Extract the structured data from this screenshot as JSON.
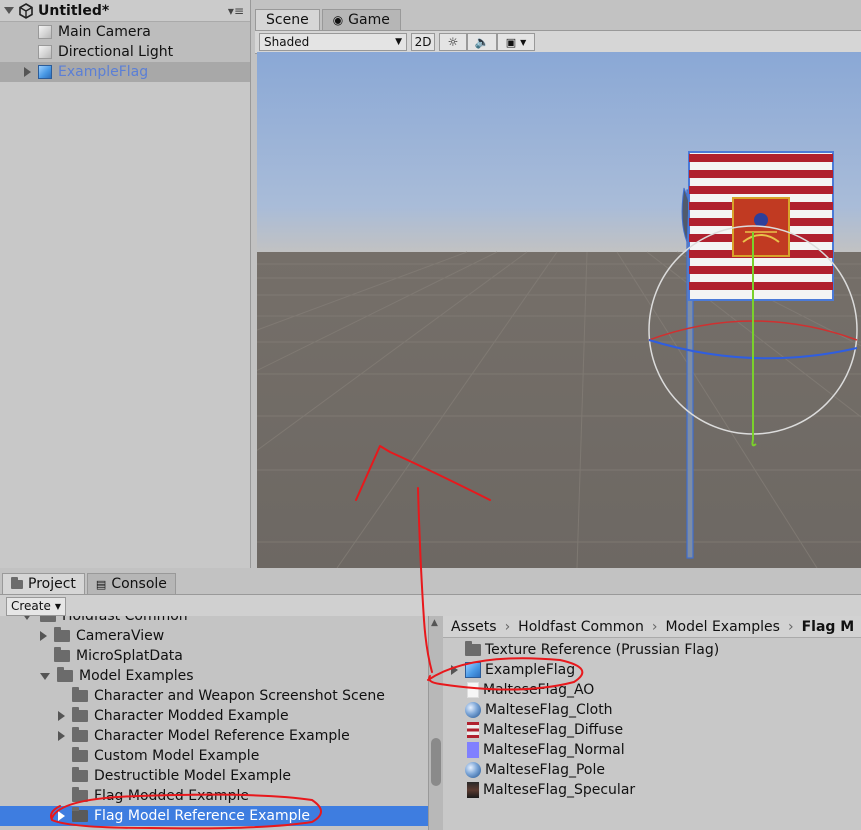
{
  "hierarchy": {
    "scene_name": "Untitled*",
    "items": [
      {
        "label": "Main Camera"
      },
      {
        "label": "Directional Light"
      },
      {
        "label": "ExampleFlag"
      }
    ]
  },
  "scene_view": {
    "tabs": [
      {
        "label": "Scene"
      },
      {
        "label": "Game"
      }
    ],
    "toolbar": {
      "shading_mode": "Shaded",
      "mode_2d": "2D"
    }
  },
  "project": {
    "tabs": [
      {
        "label": "Project"
      },
      {
        "label": "Console"
      }
    ],
    "create_label": "Create",
    "tree": [
      {
        "label": "Holdfast Common"
      },
      {
        "label": "CameraView"
      },
      {
        "label": "MicroSplatData"
      },
      {
        "label": "Model Examples"
      },
      {
        "label": "Character and Weapon Screenshot Scene"
      },
      {
        "label": "Character Modded Example"
      },
      {
        "label": "Character Model Reference Example"
      },
      {
        "label": "Custom Model Example"
      },
      {
        "label": "Destructible Model Example"
      },
      {
        "label": "Flag Modded Example"
      },
      {
        "label": "Flag Model Reference Example"
      }
    ],
    "breadcrumb": [
      "Assets",
      "Holdfast Common",
      "Model Examples",
      "Flag M"
    ],
    "assets": [
      {
        "label": "Texture Reference (Prussian Flag)",
        "icon": "folder-icon"
      },
      {
        "label": "ExampleFlag",
        "icon": "prefab-icon"
      },
      {
        "label": "MalteseFlag_AO",
        "icon": "texture-icon"
      },
      {
        "label": "MalteseFlag_Cloth",
        "icon": "material-icon"
      },
      {
        "label": "MalteseFlag_Diffuse",
        "icon": "texture-icon"
      },
      {
        "label": "MalteseFlag_Normal",
        "icon": "texture-icon"
      },
      {
        "label": "MalteseFlag_Pole",
        "icon": "material-icon"
      },
      {
        "label": "MalteseFlag_Specular",
        "icon": "texture-icon"
      }
    ]
  },
  "colors": {
    "selection_blue": "#3e7de0",
    "annotation_red": "#e8181c",
    "flag_red": "#b0202e"
  }
}
